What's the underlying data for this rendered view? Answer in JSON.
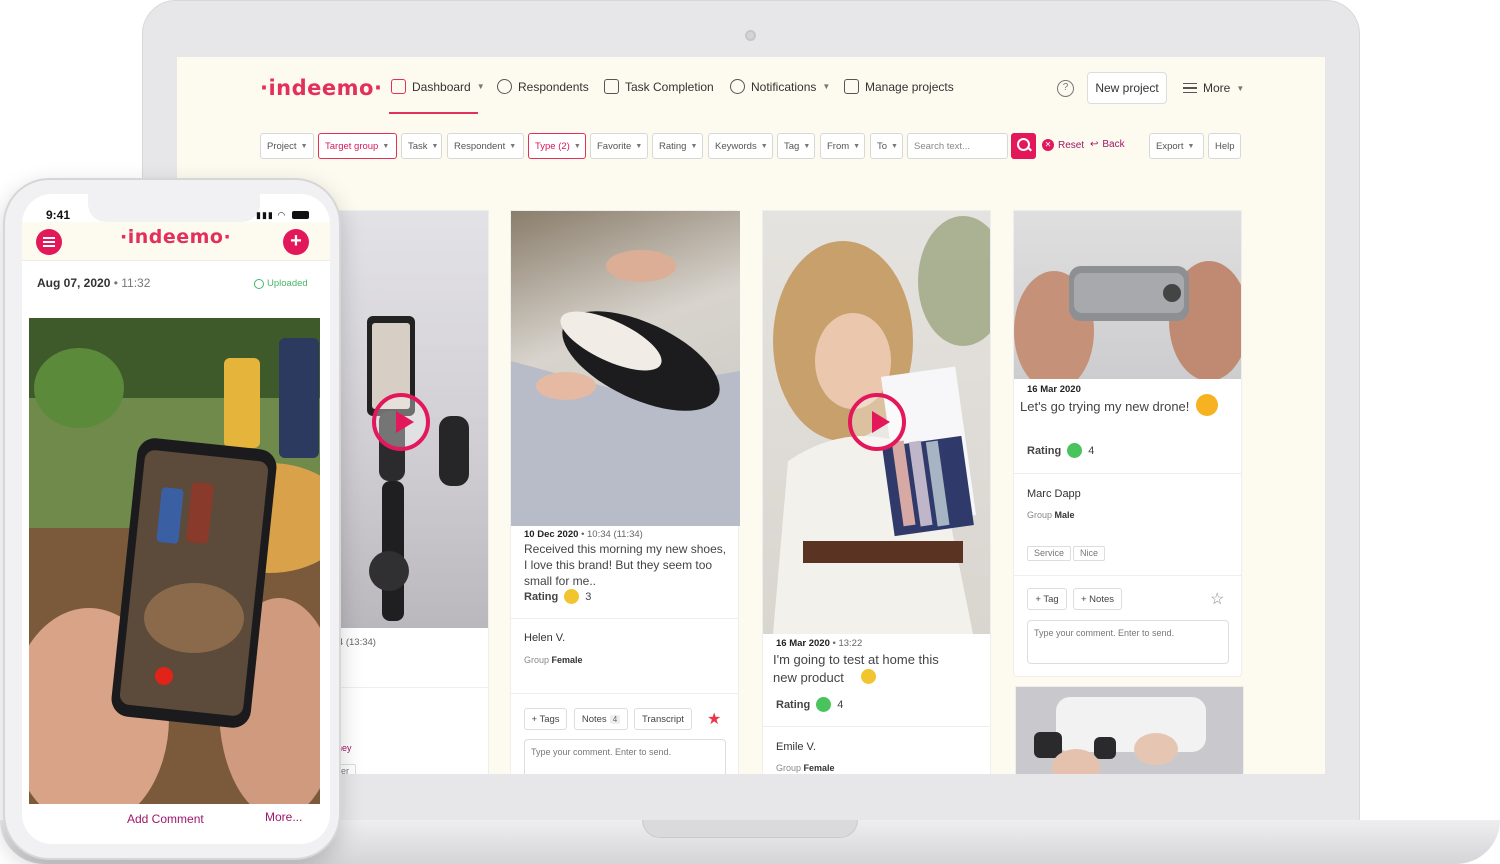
{
  "brand": {
    "logo": "·indeemo·",
    "accent": "#e2185a",
    "link_color": "#a0166a"
  },
  "nav": {
    "items": [
      {
        "label": "Dashboard",
        "icon": "calendar-icon",
        "active": true
      },
      {
        "label": "Respondents",
        "icon": "user-icon"
      },
      {
        "label": "Task Completion",
        "icon": "checkbox-icon"
      },
      {
        "label": "Notifications",
        "icon": "bell-icon"
      },
      {
        "label": "Manage projects",
        "icon": "inbox-icon"
      }
    ],
    "help": "?",
    "new_project": "New project",
    "more": "More"
  },
  "filters": {
    "items": [
      "Project",
      "Target group",
      "Task",
      "Respondent",
      "Type (2)",
      "Favorite",
      "Rating",
      "Keywords",
      "Tag",
      "From",
      "To"
    ],
    "search_placeholder": "Search text...",
    "reset": "Reset",
    "back": "Back",
    "export": "Export",
    "help": "Help"
  },
  "cards": {
    "c1": {
      "time_fragment": ":34 (13:34)",
      "tag_fragment": "urney",
      "chip_fragment": "User"
    },
    "c2": {
      "date": "10 Dec 2020",
      "time": "• 10:34 (11:34)",
      "text": "Received this morning my new shoes, I love this brand! But they seem too small for me..",
      "rating_label": "Rating",
      "rating_value": "3",
      "name": "Helen V.",
      "group_label": "Group",
      "group_value": "Female",
      "tags_btn": "+ Tags",
      "notes_btn": "Notes",
      "notes_count": "4",
      "transcript_btn": "Transcript",
      "comment_placeholder": "Type your comment. Enter to send."
    },
    "c3": {
      "date": "16 Mar 2020",
      "time": "• 13:22",
      "text": "I'm going to test at home this new product",
      "rating_label": "Rating",
      "rating_value": "4",
      "name": "Emile V.",
      "group_label": "Group",
      "group_value": "Female"
    },
    "c4": {
      "date": "16 Mar 2020",
      "text": "Let's go trying my new drone!",
      "rating_label": "Rating",
      "rating_value": "4",
      "name": "Marc Dapp",
      "group_label": "Group",
      "group_value": "Male",
      "tags": [
        "Service",
        "Nice"
      ],
      "tag_btn": "+ Tag",
      "notes_btn": "+ Notes",
      "comment_placeholder": "Type your comment. Enter to send."
    }
  },
  "phone": {
    "time": "9:41",
    "logo": "·indeemo·",
    "date": "Aug 07, 2020",
    "time_of_entry": "• 11:32",
    "uploaded": "Uploaded",
    "add_comment": "Add Comment",
    "more": "More..."
  }
}
